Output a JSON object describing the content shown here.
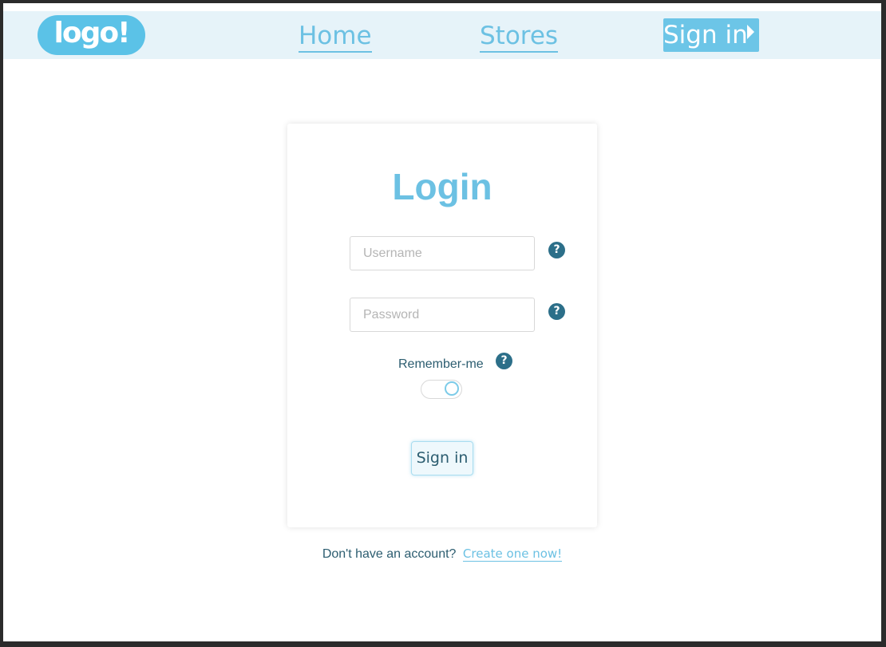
{
  "header": {
    "logo_text": "logo!",
    "nav": {
      "home": "Home",
      "stores": "Stores",
      "signin": "Sign in"
    }
  },
  "login_card": {
    "title": "Login",
    "username_placeholder": "Username",
    "password_placeholder": "Password",
    "remember_label": "Remember-me",
    "help_glyph": "?",
    "remember_enabled": true,
    "submit_label": "Sign in"
  },
  "footer": {
    "prompt": "Don't have an account?",
    "create_link": "Create one now!"
  },
  "colors": {
    "accent": "#6cc1e3",
    "header_bg": "#e6f3f9",
    "text_dark": "#2c5d70",
    "help_icon_bg": "#2c6f89"
  },
  "icons": [
    "logo",
    "question-circle-icon",
    "caret-right-icon",
    "toggle-switch"
  ]
}
